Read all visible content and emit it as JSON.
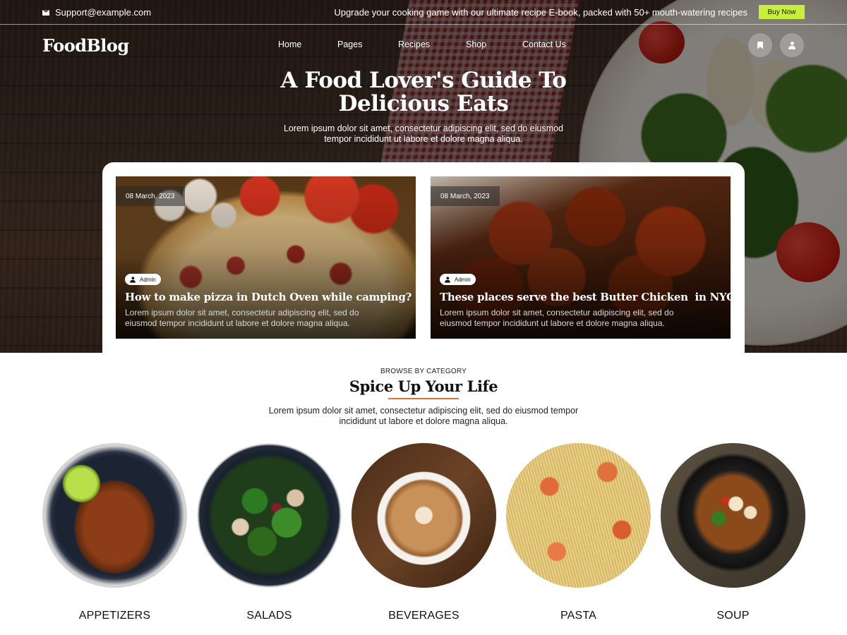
{
  "topbar": {
    "email": "Support@example.com",
    "promo": "Upgrade your cooking game with our ultimate recipe E-book, packed with 50+ mouth-watering recipes",
    "buy_label": "Buy Now"
  },
  "nav": {
    "logo": "FoodBlog",
    "items": [
      "Home",
      "Pages",
      "Recipes",
      "Shop",
      "Contact Us"
    ]
  },
  "hero": {
    "title_line1": "A Food Lover's Guide To",
    "title_line2": "Delicious Eats",
    "subtitle_line1": "Lorem ipsum dolor sit amet, consectetur adipiscing elit, sed do eiusmod",
    "subtitle_line2": "tempor incididunt ut labore et dolore magna aliqua."
  },
  "posts": [
    {
      "date": "08 March, 2023",
      "author": "Admin",
      "title": "How to make pizza in Dutch Oven while camping?",
      "excerpt": "Lorem ipsum dolor sit amet, consectetur adipiscing elit, sed do eiusmod tempor incididunt ut labore et dolore magna aliqua."
    },
    {
      "date": "08 March, 2023",
      "author": "Admin",
      "title": "These places serve the best Butter Chicken  in NYC",
      "excerpt": "Lorem ipsum dolor sit amet, consectetur adipiscing elit, sed do eiusmod tempor incididunt ut labore et dolore magna aliqua."
    }
  ],
  "categories_section": {
    "eyebrow": "BROWSE BY CATEGORY",
    "title": "Spice Up Your Life",
    "subtitle_line1": "Lorem ipsum dolor sit amet, consectetur adipiscing elit, sed do eiusmod tempor",
    "subtitle_line2": "incididunt ut labore et dolore magna aliqua.",
    "items": [
      "APPETIZERS",
      "SALADS",
      "BEVERAGES",
      "PASTA",
      "SOUP"
    ]
  },
  "colors": {
    "buy_button": "#c8f038",
    "title_underline": "#e07030"
  }
}
